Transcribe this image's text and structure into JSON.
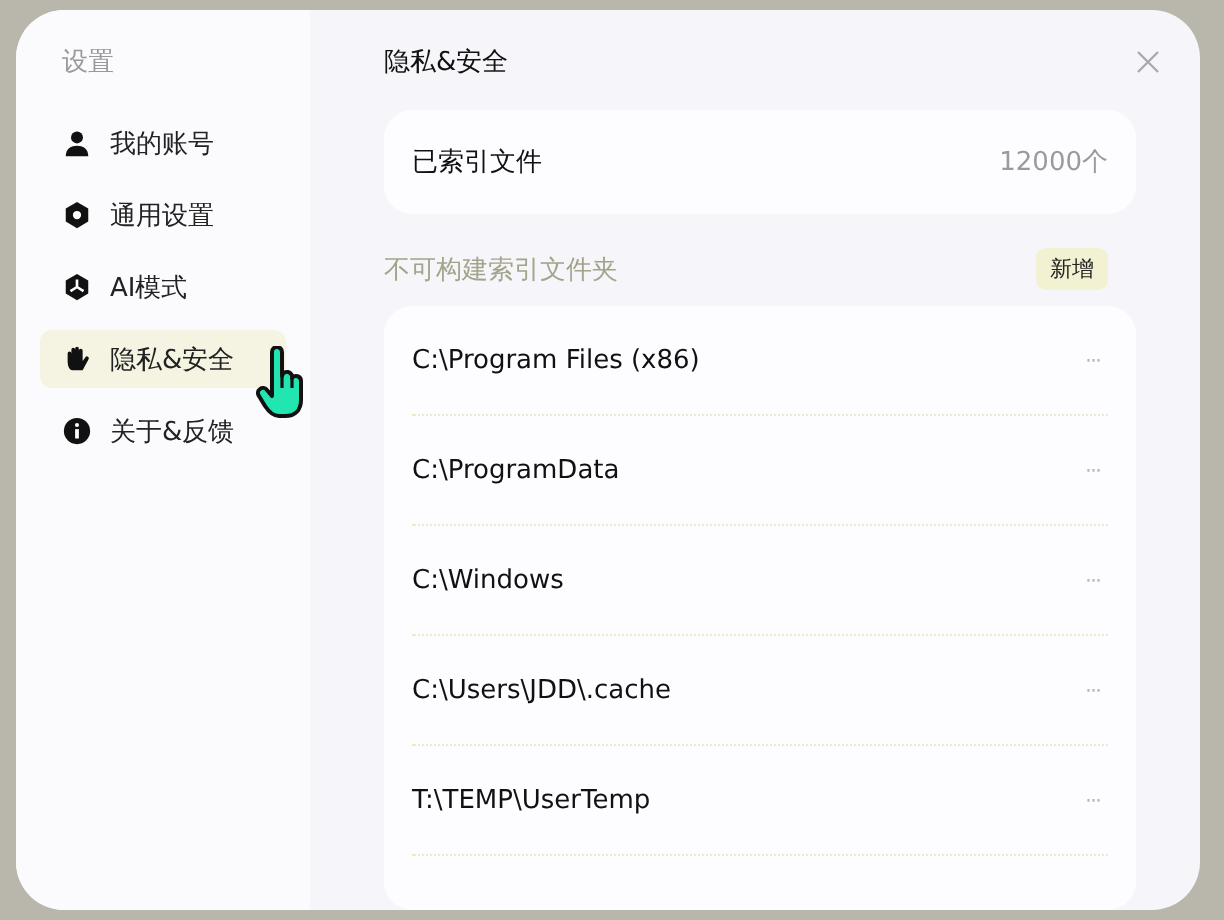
{
  "sidebar": {
    "title": "设置",
    "items": [
      {
        "label": "我的账号",
        "selected": false
      },
      {
        "label": "通用设置",
        "selected": false
      },
      {
        "label": "AI模式",
        "selected": false
      },
      {
        "label": "隐私&安全",
        "selected": true
      },
      {
        "label": "关于&反馈",
        "selected": false
      }
    ]
  },
  "main": {
    "title": "隐私&安全",
    "indexed": {
      "label": "已索引文件",
      "count": "12000个"
    },
    "excluded": {
      "title": "不可构建索引文件夹",
      "add_button": "新增",
      "folders": [
        {
          "path": "C:\\Program Files (x86)",
          "menu": "···"
        },
        {
          "path": "C:\\ProgramData",
          "menu": "···"
        },
        {
          "path": "C:\\Windows",
          "menu": "···"
        },
        {
          "path": "C:\\Users\\JDD\\.cache",
          "menu": "···"
        },
        {
          "path": "T:\\TEMP\\UserTemp",
          "menu": "···"
        }
      ]
    }
  }
}
